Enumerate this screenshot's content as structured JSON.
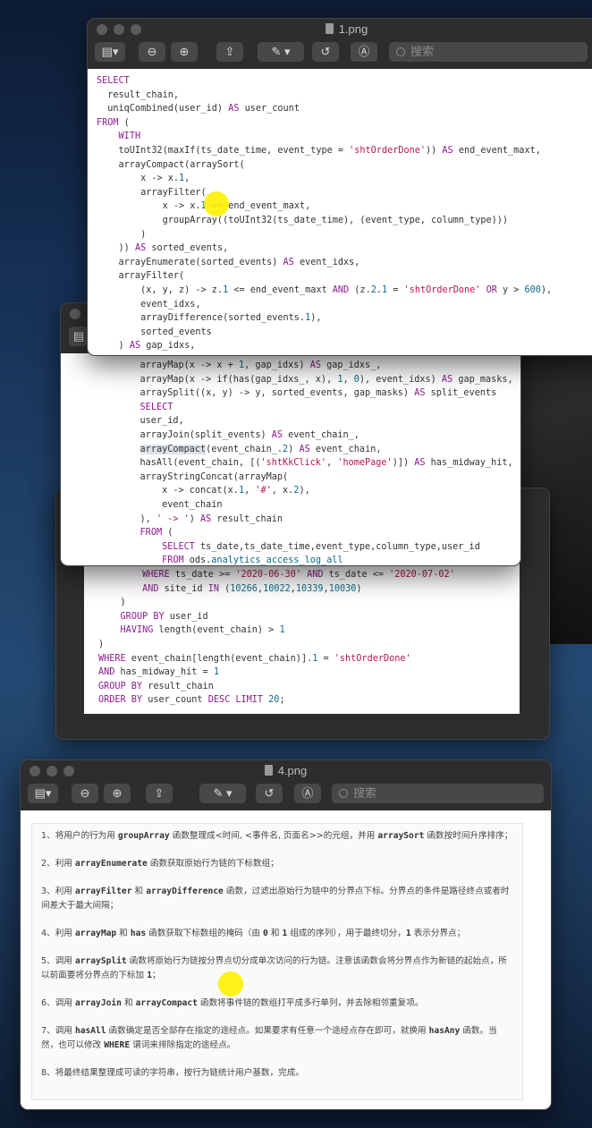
{
  "window1": {
    "title": "1.png",
    "search_placeholder": "搜索"
  },
  "window2": {
    "title": "",
    "search_placeholder": ""
  },
  "window3": {
    "title": "4.png",
    "search_placeholder": "搜索"
  },
  "code1": [
    "<span class=\"kw\">SELECT</span>",
    "  result_chain,",
    "  uniqCombined(user_id) <span class=\"kw\">AS</span> user_count",
    "<span class=\"kw\">FROM</span> (",
    "    <span class=\"kw\">WITH</span>",
    "    toUInt32(maxIf(ts_date_time, event_type = <span class=\"str\">'shtOrderDone'</span>)) <span class=\"kw\">AS</span> end_event_maxt,",
    "    arrayCompact(arraySort(",
    "        x -> x.<span class=\"num\">1</span>,",
    "        arrayFilter(",
    "            x -> x.<span class=\"num\">1</span> <= end_event_maxt,",
    "            groupArray((toUInt32(ts_date_time), (event_type, column_type)))",
    "        )",
    "    )) <span class=\"kw\">AS</span> sorted_events,",
    "    arrayEnumerate(sorted_events) <span class=\"kw\">AS</span> event_idxs,",
    "    arrayFilter(",
    "        (x, y, z) -> z.<span class=\"num\">1</span> <= end_event_maxt <span class=\"kw\">AND</span> (z.<span class=\"num\">2</span>.<span class=\"num\">1</span> = <span class=\"str\">'shtOrderDone'</span> <span class=\"kw\">OR</span> y > <span class=\"num\">600</span>),",
    "        event_idxs,",
    "        arrayDifference(sorted_events.<span class=\"num\">1</span>),",
    "        sorted_events",
    "    ) <span class=\"kw\">AS</span> gap_idxs,"
  ],
  "code2": [
    "    arrayMap(x -> x + <span class=\"num\">1</span>, gap_idxs) <span class=\"kw\">AS</span> gap_idxs_,",
    "    arrayMap(x -> if(has(gap_idxs_, x), <span class=\"num\">1</span>, <span class=\"num\">0</span>), event_idxs) <span class=\"kw\">AS</span> gap_masks,",
    "    arraySplit((x, y) -> y, sorted_events, gap_masks) <span class=\"kw\">AS</span> split_events",
    "    <span class=\"kw\">SELECT</span>",
    "    user_id,",
    "    arrayJoin(split_events) <span class=\"kw\">AS</span> event_chain_,",
    "    <span style=\"background:#dde3ea\">arrayCompact</span>(event_chain_.<span class=\"num\">2</span>) <span class=\"kw\">AS</span> event_chain,",
    "    hasAll(event_chain, [(<span class=\"str\">'shtKkClick'</span>, <span class=\"str\">'homePage'</span>)]) <span class=\"kw\">AS</span> has_midway_hit,",
    "    arrayStringConcat(arrayMap(",
    "        x -> concat(x.<span class=\"num\">1</span>, <span class=\"str\">'#'</span>, x.<span class=\"num\">2</span>),",
    "        event_chain",
    "    ), <span class=\"str\">' -> '</span>) <span class=\"kw\">AS</span> result_chain",
    "    <span class=\"kw\">FROM</span> (",
    "        <span class=\"kw\">SELECT</span> ts_date,ts_date_time,event_type,column_type,user_id",
    "        <span class=\"kw\">FROM</span> ods.<span class=\"num\">analytics_access_log_all</span>"
  ],
  "code3": [
    "        <span class=\"kw\">WHERE</span> ts_date >= <span class=\"str\">'2020-06-30'</span> <span class=\"kw\">AND</span> ts_date <= <span class=\"str\">'2020-07-02'</span>",
    "        <span class=\"kw\">AND</span> site_id <span class=\"kw\">IN</span> (<span class=\"num\">10266</span>,<span class=\"num\">10022</span>,<span class=\"num\">10339</span>,<span class=\"num\">10030</span>)",
    "    )",
    "    <span class=\"kw\">GROUP BY</span> user_id",
    "    <span class=\"kw\">HAVING</span> length(event_chain) > <span class=\"num\">1</span>",
    ")",
    "<span class=\"kw\">WHERE</span> event_chain[length(event_chain)].<span class=\"num\">1</span> = <span class=\"str\">'shtOrderDone'</span>",
    "<span class=\"kw\">AND</span> has_midway_hit = <span class=\"num\">1</span>",
    "<span class=\"kw\">GROUP BY</span> result_chain",
    "<span class=\"kw\">ORDER BY</span> user_count <span class=\"kw\">DESC LIMIT</span> <span class=\"num\">20</span>;"
  ],
  "notes": [
    "1、将用户的行为用 <code>groupArray</code> 函数整理成&lt;时间, &lt;事件名, 页面名&gt;&gt;的元组，并用 <code>arraySort</code> 函数按时间升序排序；",
    "2、利用 <code>arrayEnumerate</code> 函数获取原始行为链的下标数组；",
    "3、利用 <code>arrayFilter</code> 和 <code>arrayDifference</code> 函数，过滤出原始行为链中的分界点下标。分界点的条件是路径终点或者时间差大于最大间隔；",
    "4、利用 <code>arrayMap</code> 和 <code>has</code> 函数获取下标数组的掩码（由 <code>0</code> 和 <code>1</code> 组成的序列），用于最终切分，<code>1</code> 表示分界点；",
    "5、调用 <code>arraySplit</code> 函数将原始行为链按分界点切分成单次访问的行为链。注意该函数会将分界点作为新链的起始点，所以前面要将分界点的下标加 <code>1</code>；",
    "6、调用 <code>arrayJoin</code> 和 <code>arrayCompact</code> 函数将事件链的数组打平成多行单列，并去除相邻重复项。",
    "7、调用 <code>hasAll</code> 函数确定是否全部存在指定的途经点。如果要求有任意一个途经点存在即可，就换用 <code>hasAny</code> 函数。当然，也可以修改 <code>WHERE</code> 谓词来排除指定的途经点。",
    "8、将最终结果整理成可读的字符串，按行为链统计用户基数，完成。"
  ]
}
